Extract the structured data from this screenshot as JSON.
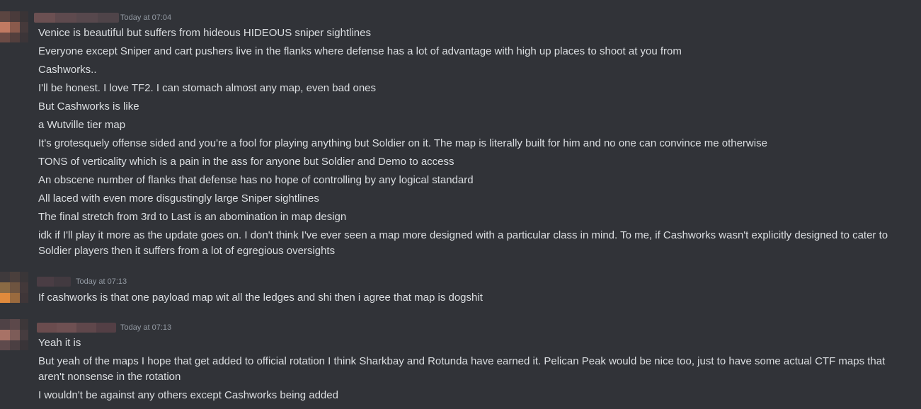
{
  "chat": {
    "groups": [
      {
        "author": "",
        "timestamp": "Today at 07:04",
        "messages": [
          "Venice is beautiful but suffers from hideous HIDEOUS sniper sightlines",
          "Everyone except Sniper and cart pushers live in the flanks where defense has a lot of advantage with high up places to shoot at you from",
          "Cashworks..",
          "I'll be honest. I love TF2. I can stomach almost any map, even bad ones",
          "But Cashworks is like",
          "a Wutville tier map",
          "It's grotesquely offense sided and you're a fool for playing anything but Soldier on it. The map is literally built for him and no one can convince me otherwise",
          "TONS of verticality which is a pain in the ass for anyone but Soldier and Demo to access",
          "An obscene number of flanks that defense has no hope of controlling by any logical standard",
          "All laced with even more disgustingly large Sniper sightlines",
          "The final stretch from 3rd to Last is an abomination in map design",
          "idk if I'll play it more as the update goes on. I don't think I've ever seen a map more designed with a particular class in mind. To me, if Cashworks wasn't explicitly designed to cater to Soldier players then it suffers from a lot of egregious oversights"
        ]
      },
      {
        "author": "",
        "timestamp": "Today at 07:13",
        "messages": [
          "If cashworks is that one payload map wit all the ledges and shi then i agree that map is dogshit"
        ]
      },
      {
        "author": "",
        "timestamp": "Today at 07:13",
        "messages": [
          "Yeah it is",
          "But yeah of the maps I hope that get added to official rotation I think Sharkbay and Rotunda have earned it. Pelican Peak would be nice too, just to have some actual CTF maps that aren't nonsense in the rotation",
          "I wouldn't be against any others except Cashworks being added"
        ]
      }
    ]
  }
}
